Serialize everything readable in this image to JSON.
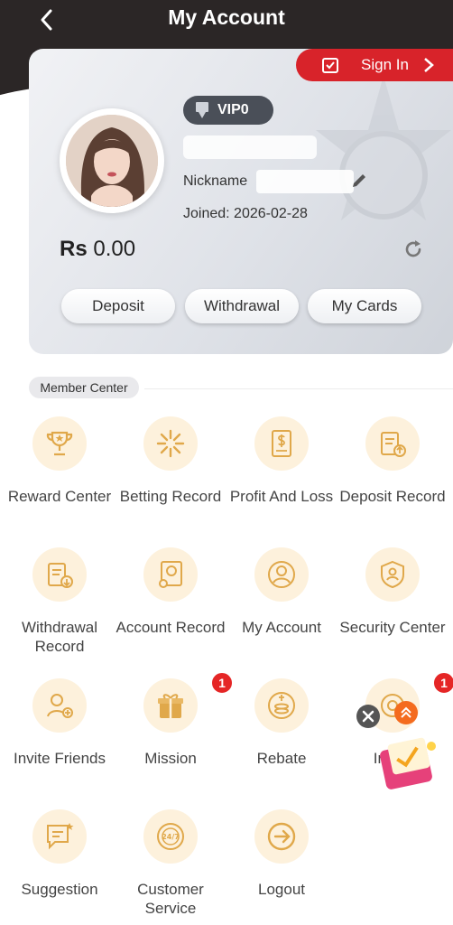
{
  "header": {
    "title": "My Account"
  },
  "signin": {
    "label": "Sign In"
  },
  "profile": {
    "vip_label": "VIP0",
    "nickname_label": "Nickname",
    "joined_label": "Joined:",
    "joined_date": "2026-02-28"
  },
  "balance": {
    "currency": "Rs",
    "amount": "0.00"
  },
  "actions": {
    "deposit": "Deposit",
    "withdrawal": "Withdrawal",
    "my_cards": "My Cards"
  },
  "member_center": {
    "title": "Member Center",
    "items": [
      {
        "label": "Reward Center",
        "icon": "trophy-icon"
      },
      {
        "label": "Betting Record",
        "icon": "star-burst-icon"
      },
      {
        "label": "Profit And Loss",
        "icon": "dollar-document-icon"
      },
      {
        "label": "Deposit Record",
        "icon": "clipboard-up-icon"
      },
      {
        "label": "Withdrawal Record",
        "icon": "clipboard-down-icon"
      },
      {
        "label": "Account Record",
        "icon": "ledger-icon"
      },
      {
        "label": "My Account",
        "icon": "user-icon"
      },
      {
        "label": "Security Center",
        "icon": "shield-user-icon"
      },
      {
        "label": "Invite Friends",
        "icon": "add-user-icon"
      },
      {
        "label": "Mission",
        "icon": "gift-icon",
        "badge": "1"
      },
      {
        "label": "Rebate",
        "icon": "coins-icon"
      },
      {
        "label": "In Me",
        "icon": "message-icon",
        "badge": "1"
      },
      {
        "label": "Suggestion",
        "icon": "feedback-icon"
      },
      {
        "label": "Customer Service",
        "icon": "support-24-7-icon"
      },
      {
        "label": "Logout",
        "icon": "logout-icon"
      }
    ]
  },
  "colors": {
    "accent": "#d8232a",
    "icon_gold": "#e0a84a",
    "icon_bg": "#fdf1dc",
    "header_bg": "#2b2626"
  }
}
